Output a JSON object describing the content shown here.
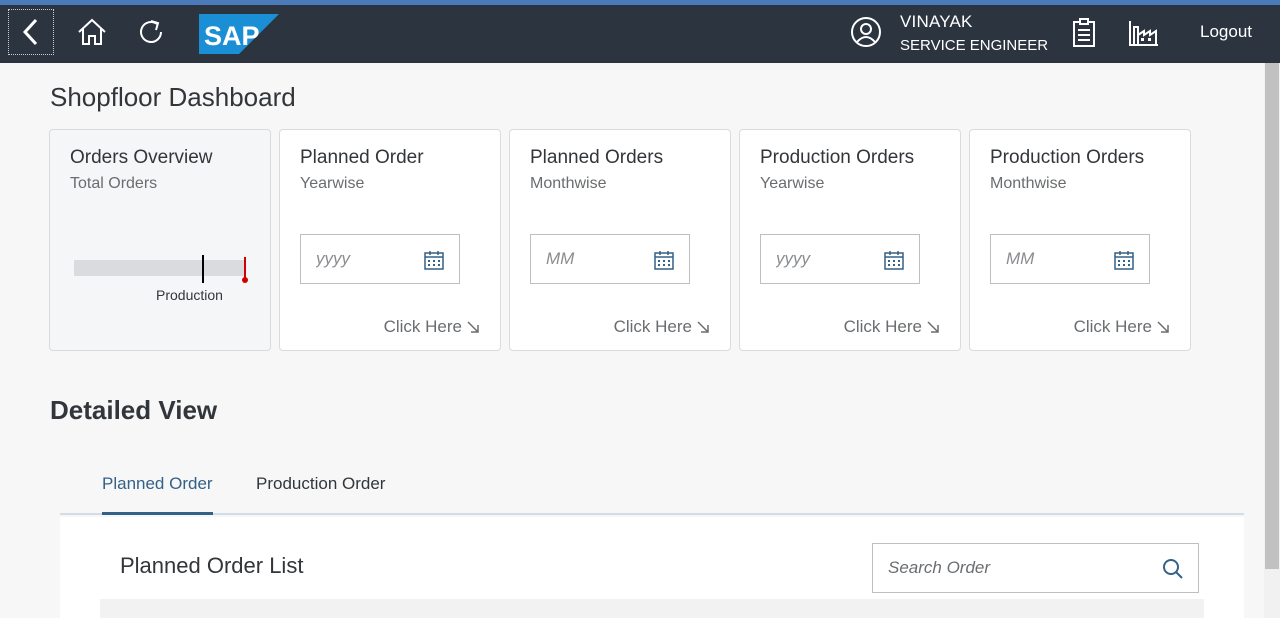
{
  "shell": {
    "logo_text": "SAP",
    "user_name": "VINAYAK",
    "user_role": "SERVICE ENGINEER",
    "logout_label": "Logout",
    "icons": [
      "back-icon",
      "home-icon",
      "refresh-icon",
      "user-icon",
      "clipboard-icon",
      "factory-icon"
    ]
  },
  "page": {
    "title": "Shopfloor Dashboard"
  },
  "tiles": [
    {
      "title": "Orders Overview",
      "subtitle": "Total Orders",
      "chart_label": "Production"
    },
    {
      "title": "Planned Order",
      "subtitle": "Yearwise",
      "placeholder": "yyyy",
      "link": "Click Here"
    },
    {
      "title": "Planned Orders",
      "subtitle": "Monthwise",
      "placeholder": "MM",
      "link": "Click Here"
    },
    {
      "title": "Production Orders",
      "subtitle": "Yearwise",
      "placeholder": "yyyy",
      "link": "Click Here"
    },
    {
      "title": "Production Orders",
      "subtitle": "Monthwise",
      "placeholder": "MM",
      "link": "Click Here"
    }
  ],
  "detailed": {
    "title": "Detailed View",
    "tabs": [
      {
        "label": "Planned Order",
        "active": true
      },
      {
        "label": "Production Order",
        "active": false
      }
    ],
    "list_title": "Planned Order List",
    "search_placeholder": "Search Order"
  },
  "colors": {
    "shell_bg": "#2c3440",
    "accent": "#346187",
    "target_marker": "#d00000"
  }
}
